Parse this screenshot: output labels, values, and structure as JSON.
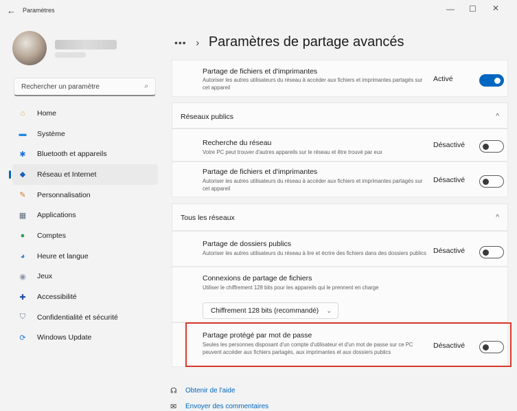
{
  "window": {
    "title": "Paramètres",
    "back": "←",
    "minimize": "—",
    "maximize": "☐",
    "close": "✕"
  },
  "sidebar": {
    "search_placeholder": "Rechercher un paramètre",
    "search_icon": "⌕",
    "items": [
      {
        "label": "Home",
        "icon": "home-icon",
        "glyph": "⌂",
        "color": "#e8a93a"
      },
      {
        "label": "Système",
        "icon": "monitor-icon",
        "glyph": "▬",
        "color": "#1e88e5"
      },
      {
        "label": "Bluetooth et appareils",
        "icon": "bluetooth-icon",
        "glyph": "✱",
        "color": "#1e6fd9"
      },
      {
        "label": "Réseau et Internet",
        "icon": "wifi-icon",
        "glyph": "◆",
        "color": "#1b5fb8"
      },
      {
        "label": "Personnalisation",
        "icon": "brush-icon",
        "glyph": "✎",
        "color": "#c97a2a"
      },
      {
        "label": "Applications",
        "icon": "apps-icon",
        "glyph": "▦",
        "color": "#5a6b82"
      },
      {
        "label": "Comptes",
        "icon": "person-icon",
        "glyph": "●",
        "color": "#2f9e57"
      },
      {
        "label": "Heure et langue",
        "icon": "globe-icon",
        "glyph": "◕",
        "color": "#2a7fd0"
      },
      {
        "label": "Jeux",
        "icon": "gamepad-icon",
        "glyph": "◉",
        "color": "#8a97a8"
      },
      {
        "label": "Accessibilité",
        "icon": "accessibility-icon",
        "glyph": "✚",
        "color": "#1d4fa3"
      },
      {
        "label": "Confidentialité et sécurité",
        "icon": "shield-icon",
        "glyph": "⛉",
        "color": "#6f7b8a"
      },
      {
        "label": "Windows Update",
        "icon": "update-icon",
        "glyph": "⟳",
        "color": "#1e7bd6"
      }
    ],
    "active_index": 3
  },
  "main": {
    "breadcrumb_dots": "•••",
    "breadcrumb_sep": "›",
    "title": "Paramètres de partage avancés",
    "top_row": {
      "title": "Partage de fichiers et d'imprimantes",
      "desc": "Autoriser les autres utilisateurs du réseau à accéder aux fichiers et imprimantes partagés sur cet appareil",
      "state": "Activé",
      "on": true
    },
    "public_section": {
      "label": "Réseaux publics",
      "chevron": "^",
      "rows": [
        {
          "title": "Recherche du réseau",
          "desc": "Votre PC peut trouver d'autres appareils sur le réseau et être trouvé par eux",
          "state": "Désactivé"
        },
        {
          "title": "Partage de fichiers et d'imprimantes",
          "desc": "Autoriser les autres utilisateurs du réseau à accéder aux fichiers et imprimantes partagés sur cet appareil",
          "state": "Désactivé"
        }
      ]
    },
    "all_section": {
      "label": "Tous les réseaux",
      "chevron": "^",
      "public_folders": {
        "title": "Partage de dossiers publics",
        "desc": "Autoriser les autres utilisateurs du réseau à lire et écrire des fichiers dans des dossiers publics",
        "state": "Désactivé"
      },
      "file_sharing": {
        "title": "Connexions de partage de fichiers",
        "desc": "Utiliser le chiffrement 128 bits pour les appareils qui le prennent en charge",
        "dropdown_value": "Chiffrement 128 bits (recommandé)",
        "dropdown_chevron": "⌄"
      },
      "password_protected": {
        "title": "Partage protégé par mot de passe",
        "desc": "Seules les personnes disposant d'un compte d'utilisateur et d'un mot de passe sur ce PC peuvent accéder aux fichiers partagés, aux imprimantes et aux dossiers publics",
        "state": "Désactivé"
      }
    },
    "links": [
      {
        "label": "Obtenir de l'aide",
        "icon": "help-icon",
        "glyph": "☊"
      },
      {
        "label": "Envoyer des commentaires",
        "icon": "feedback-icon",
        "glyph": "✉"
      }
    ]
  }
}
